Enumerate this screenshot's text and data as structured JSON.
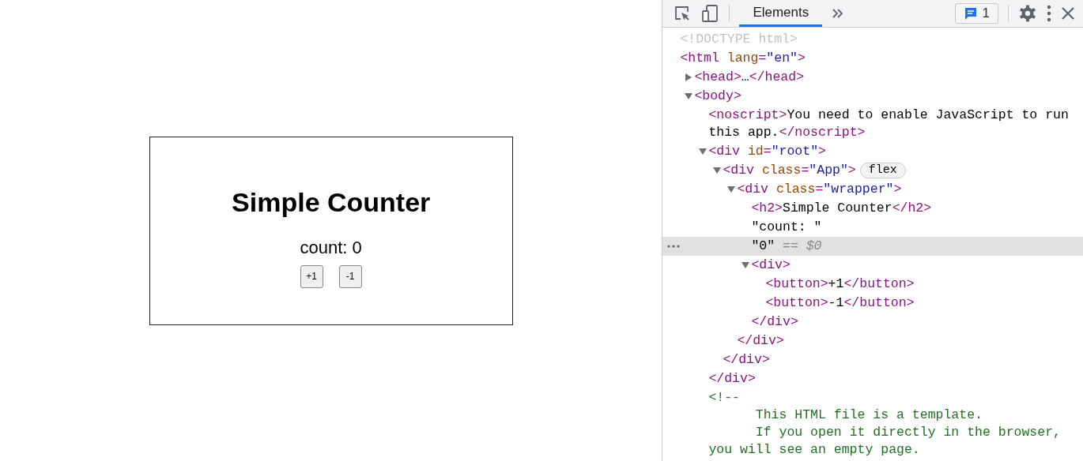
{
  "page": {
    "heading": "Simple Counter",
    "count_label": "count: 0",
    "buttons": [
      "+1",
      "-1"
    ]
  },
  "devtools": {
    "tabs": [
      {
        "label": "Elements",
        "selected": true
      }
    ],
    "issues_count": "1",
    "tree": [
      {
        "parts": [
          {
            "kind": "doctype",
            "text": "<!DOCTYPE html>"
          }
        ]
      },
      {
        "parts": [
          {
            "kind": "tag",
            "text": "<html "
          },
          {
            "kind": "attr",
            "text": "lang"
          },
          {
            "kind": "tag",
            "text": "="
          },
          {
            "kind": "value",
            "text": "\"en\""
          },
          {
            "kind": "tag",
            "text": ">"
          }
        ],
        "children": [
          {
            "parts": [
              {
                "kind": "tag",
                "text": "<head>"
              },
              {
                "kind": "text",
                "text": "…"
              },
              {
                "kind": "tag",
                "text": "</head>"
              }
            ],
            "expanded": false
          },
          {
            "parts": [
              {
                "kind": "tag",
                "text": "<body>"
              }
            ],
            "expanded": true,
            "children": [
              {
                "parts": [
                  {
                    "kind": "tag",
                    "text": "<noscript>"
                  },
                  {
                    "kind": "text",
                    "text": "You need to enable JavaScript to run this app."
                  },
                  {
                    "kind": "tag",
                    "text": "</noscript>"
                  }
                ]
              },
              {
                "parts": [
                  {
                    "kind": "tag",
                    "text": "<div "
                  },
                  {
                    "kind": "attr",
                    "text": "id"
                  },
                  {
                    "kind": "tag",
                    "text": "="
                  },
                  {
                    "kind": "value",
                    "text": "\"root\""
                  },
                  {
                    "kind": "tag",
                    "text": ">"
                  }
                ],
                "expanded": true,
                "close": [
                  {
                    "kind": "tag",
                    "text": "</div>"
                  }
                ],
                "children": [
                  {
                    "parts": [
                      {
                        "kind": "tag",
                        "text": "<div "
                      },
                      {
                        "kind": "attr",
                        "text": "class"
                      },
                      {
                        "kind": "tag",
                        "text": "="
                      },
                      {
                        "kind": "value",
                        "text": "\"App\""
                      },
                      {
                        "kind": "tag",
                        "text": ">"
                      }
                    ],
                    "badge": "flex",
                    "expanded": true,
                    "close": [
                      {
                        "kind": "tag",
                        "text": "</div>"
                      }
                    ],
                    "children": [
                      {
                        "parts": [
                          {
                            "kind": "tag",
                            "text": "<div "
                          },
                          {
                            "kind": "attr",
                            "text": "class"
                          },
                          {
                            "kind": "tag",
                            "text": "="
                          },
                          {
                            "kind": "value",
                            "text": "\"wrapper\""
                          },
                          {
                            "kind": "tag",
                            "text": ">"
                          }
                        ],
                        "expanded": true,
                        "close": [
                          {
                            "kind": "tag",
                            "text": "</div>"
                          }
                        ],
                        "children": [
                          {
                            "parts": [
                              {
                                "kind": "tag",
                                "text": "<h2>"
                              },
                              {
                                "kind": "text",
                                "text": "Simple Counter"
                              },
                              {
                                "kind": "tag",
                                "text": "</h2>"
                              }
                            ]
                          },
                          {
                            "parts": [
                              {
                                "kind": "text",
                                "text": "\"count: \""
                              }
                            ]
                          },
                          {
                            "parts": [
                              {
                                "kind": "text",
                                "text": "\"0\""
                              },
                              {
                                "kind": "dim",
                                "text": " == $0"
                              }
                            ],
                            "selected": true
                          },
                          {
                            "parts": [
                              {
                                "kind": "tag",
                                "text": "<div>"
                              }
                            ],
                            "expanded": true,
                            "close": [
                              {
                                "kind": "tag",
                                "text": "</div>"
                              }
                            ],
                            "children": [
                              {
                                "parts": [
                                  {
                                    "kind": "tag",
                                    "text": "<button>"
                                  },
                                  {
                                    "kind": "text",
                                    "text": "+1"
                                  },
                                  {
                                    "kind": "tag",
                                    "text": "</button>"
                                  }
                                ]
                              },
                              {
                                "parts": [
                                  {
                                    "kind": "tag",
                                    "text": "<button>"
                                  },
                                  {
                                    "kind": "text",
                                    "text": "-1"
                                  },
                                  {
                                    "kind": "tag",
                                    "text": "</button>"
                                  }
                                ]
                              }
                            ]
                          }
                        ]
                      }
                    ]
                  }
                ]
              },
              {
                "parts": [
                  {
                    "kind": "comment",
                    "text": "<!--\n      This HTML file is a template.\n      If you open it directly in the browser,\nyou will see an empty page."
                  }
                ]
              }
            ]
          }
        ]
      }
    ]
  }
}
